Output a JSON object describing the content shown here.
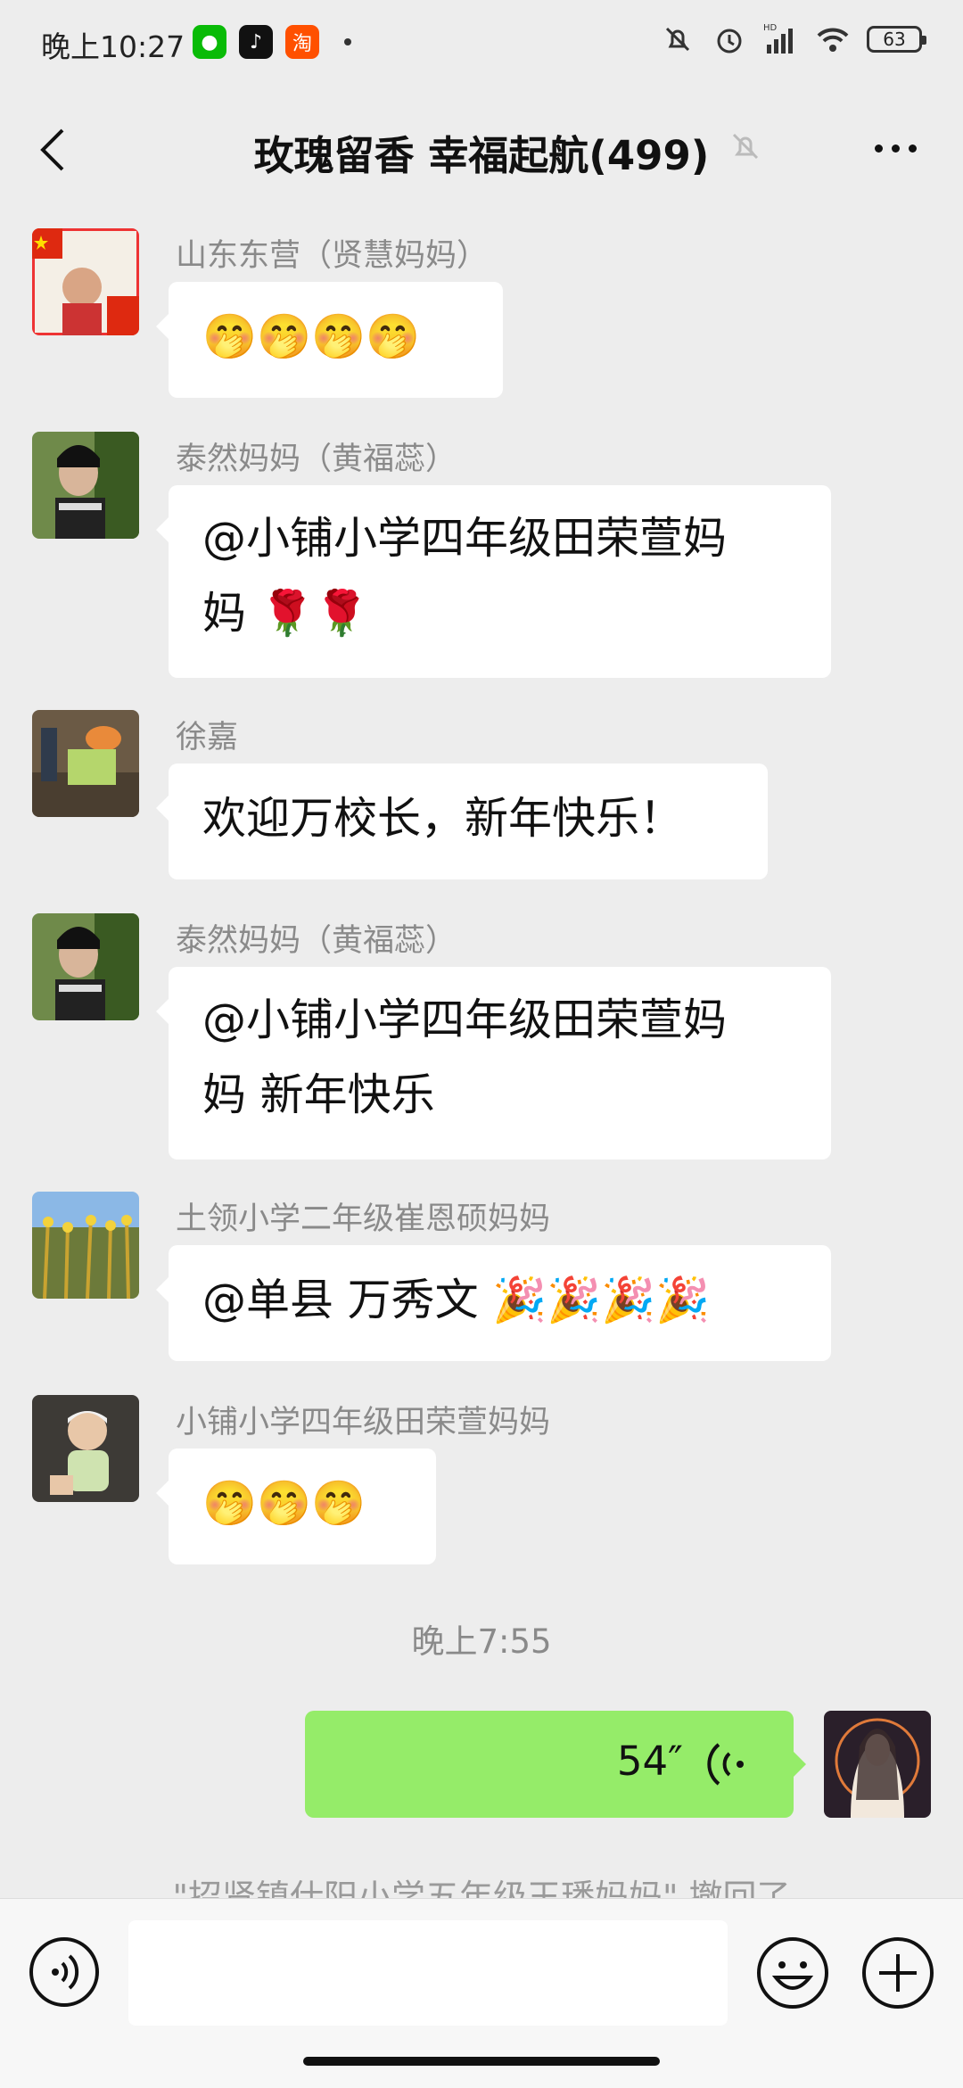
{
  "status": {
    "time": "晚上10:27",
    "battery": "63",
    "hd_label": "HD"
  },
  "header": {
    "title": "玫瑰留香  幸福起航(499)"
  },
  "messages": [
    {
      "sender": "山东东营（贤慧妈妈）",
      "text": "🤭🤭🤭🤭"
    },
    {
      "sender": "泰然妈妈（黄福蕊）",
      "line1": "@小铺小学四年级田荣萱妈",
      "line2": "妈 🌹🌹"
    },
    {
      "sender": "徐嘉",
      "text": "欢迎万校长，新年快乐！"
    },
    {
      "sender": "泰然妈妈（黄福蕊）",
      "line1": "@小铺小学四年级田荣萱妈",
      "line2": "妈  新年快乐"
    },
    {
      "sender": "土领小学二年级崔恩硕妈妈",
      "text": "@单县 万秀文 🎉🎉🎉🎉"
    },
    {
      "sender": "小铺小学四年级田荣萱妈妈",
      "text": "🤭🤭🤭"
    }
  ],
  "time_separator": "晚上7:55",
  "my_voice": {
    "duration": "54″"
  },
  "recall_note": "\"招贤镇仕阳小学五年级王璠妈妈\" 撤回了",
  "input": {
    "placeholder": ""
  },
  "colors": {
    "accent_green": "#95ec69",
    "background": "#ededed"
  }
}
